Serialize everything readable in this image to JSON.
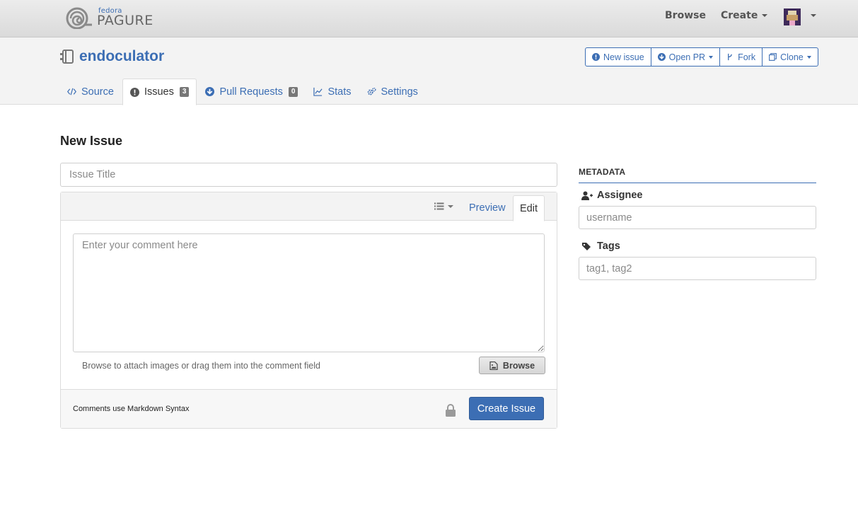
{
  "navbar": {
    "logo_small": "fedora",
    "logo_big": "PAGURE",
    "browse_label": "Browse",
    "create_label": "Create"
  },
  "project": {
    "name": "endoculator",
    "actions": {
      "new_issue": "New issue",
      "open_pr": "Open PR",
      "fork": "Fork",
      "clone": "Clone"
    },
    "tabs": [
      {
        "label": "Source",
        "icon": "code-icon"
      },
      {
        "label": "Issues",
        "icon": "exclamation-circle-icon",
        "count": "3"
      },
      {
        "label": "Pull Requests",
        "icon": "arrow-circle-down-icon",
        "count": "0"
      },
      {
        "label": "Stats",
        "icon": "line-chart-icon"
      },
      {
        "label": "Settings",
        "icon": "gears-icon"
      }
    ]
  },
  "form": {
    "page_title": "New Issue",
    "title_placeholder": "Issue Title",
    "preview_tab": "Preview",
    "edit_tab": "Edit",
    "comment_placeholder": "Enter your comment here",
    "attach_text": "Browse to attach images or drag them into the comment field",
    "browse_button": "Browse",
    "markdown_note": "Comments use Markdown Syntax",
    "create_button": "Create Issue"
  },
  "metadata": {
    "heading": "METADATA",
    "assignee_label": "Assignee",
    "assignee_placeholder": "username",
    "tags_label": "Tags",
    "tags_placeholder": "tag1, tag2"
  },
  "colors": {
    "accent": "#3c6eb4",
    "navbar": "#e2e2e2",
    "badge": "#777777"
  }
}
